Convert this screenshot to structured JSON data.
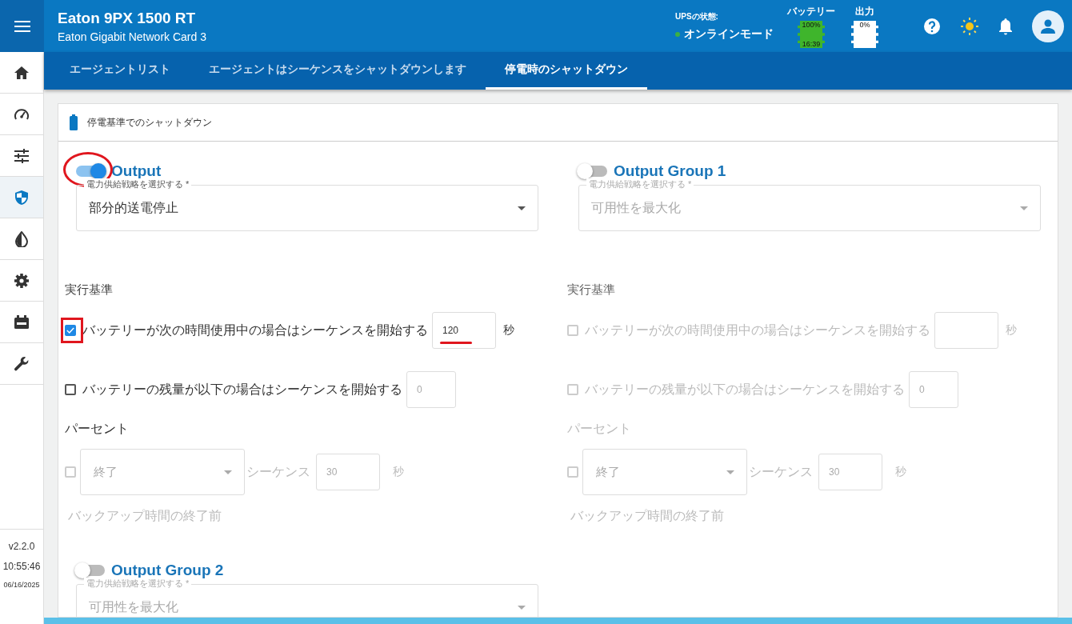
{
  "header": {
    "title": "Eaton 9PX 1500 RT",
    "subtitle": "Eaton Gigabit Network Card 3",
    "ups_status": {
      "label": "UPSの状態:",
      "value": "オンラインモード",
      "color": "#3cb043"
    },
    "battery": {
      "label": "バッテリー",
      "charge": "100%",
      "runtime": "16:39"
    },
    "output": {
      "label": "出力",
      "load": "0%"
    }
  },
  "sidebar": {
    "items": [
      {
        "kind": "home",
        "selected": false
      },
      {
        "kind": "gauge",
        "selected": false
      },
      {
        "kind": "sliders",
        "selected": false
      },
      {
        "kind": "shield",
        "selected": true
      },
      {
        "kind": "contrast",
        "selected": false
      },
      {
        "kind": "gear",
        "selected": false
      },
      {
        "kind": "ups",
        "selected": false
      },
      {
        "kind": "wrench",
        "selected": false
      }
    ],
    "version": "v2.2.0",
    "time": "10:55:46",
    "date": "06/16/2025"
  },
  "tabs": [
    {
      "label": "エージェントリスト",
      "selected": false
    },
    {
      "label": "エージェントはシーケンスをシャットダウンします",
      "selected": false
    },
    {
      "label": "停電時のシャットダウン",
      "selected": true
    }
  ],
  "panel": {
    "title": "停電基準でのシャットダウン",
    "groups": [
      {
        "name": "Output",
        "on": true,
        "enabled": true,
        "marked": true,
        "strategy_label": "電力供給戦略を選択する *",
        "strategy": "部分的送電停止",
        "criteria_title": "実行基準",
        "rules": [
          {
            "kind": "duration",
            "checked": true,
            "disabled": false,
            "marked": true,
            "label": "バッテリーが次の時間使用中の場合はシーケンスを開始する",
            "value": "120",
            "unit": "秒"
          },
          {
            "kind": "charge",
            "checked": false,
            "disabled": false,
            "label": "バッテリーの残量が以下の場合はシーケンスを開始する",
            "placeholder": "0"
          },
          {
            "kind": "caption",
            "disabled": false,
            "label": "パーセント"
          },
          {
            "kind": "sequence",
            "checked": false,
            "disabled": true,
            "select": "終了",
            "label": "シーケンス",
            "value": "30",
            "unit": "秒"
          },
          {
            "kind": "caption",
            "disabled": true,
            "label": "バックアップ時間の終了前"
          }
        ]
      },
      {
        "name": "Output Group 1",
        "on": false,
        "enabled": false,
        "strategy_label": "電力供給戦略を選択する *",
        "strategy": "可用性を最大化",
        "criteria_title": "実行基準",
        "rules": [
          {
            "kind": "duration",
            "checked": false,
            "disabled": true,
            "label": "バッテリーが次の時間使用中の場合はシーケンスを開始する",
            "unit": "秒"
          },
          {
            "kind": "charge",
            "checked": false,
            "disabled": true,
            "label": "バッテリーの残量が以下の場合はシーケンスを開始する",
            "placeholder": "0"
          },
          {
            "kind": "caption",
            "disabled": true,
            "label": "パーセント"
          },
          {
            "kind": "sequence",
            "checked": false,
            "disabled": true,
            "select": "終了",
            "label": "シーケンス",
            "value": "30",
            "unit": "秒"
          },
          {
            "kind": "caption",
            "disabled": true,
            "label": "バックアップ時間の終了前"
          }
        ]
      },
      {
        "name": "Output Group 2",
        "on": false,
        "enabled": false,
        "strategy_label": "電力供給戦略を選択する *",
        "strategy": "可用性を最大化"
      }
    ]
  }
}
